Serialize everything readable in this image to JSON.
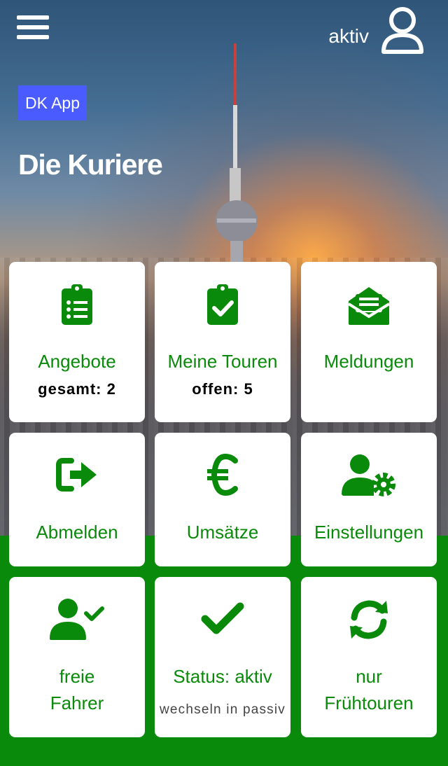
{
  "header": {
    "status_text": "aktiv",
    "app_badge": "DK App",
    "title": "Die Kuriere"
  },
  "tiles": [
    {
      "label": "Angebote",
      "sub": "gesamt: 2",
      "icon": "clipboard-list-icon"
    },
    {
      "label": "Meine Touren",
      "sub": "offen: 5",
      "icon": "clipboard-check-icon"
    },
    {
      "label": "Meldungen",
      "sub": "",
      "icon": "envelope-open-text-icon"
    },
    {
      "label": "Abmelden",
      "sub": "",
      "icon": "sign-out-icon"
    },
    {
      "label": "Umsätze",
      "sub": "",
      "icon": "euro-icon"
    },
    {
      "label": "Einstellungen",
      "sub": "",
      "icon": "user-cog-icon"
    },
    {
      "label_line1": "freie",
      "label_line2": "Fahrer",
      "icon": "user-check-icon"
    },
    {
      "label": "Status: aktiv",
      "sub": "wechseln in passiv",
      "icon": "checkmark-icon"
    },
    {
      "label_line1": "nur",
      "label_line2": "Frühtouren",
      "icon": "sync-icon"
    }
  ],
  "colors": {
    "brand_green": "#0a8a0a",
    "badge_blue": "#4a5cff",
    "tile_bg": "#ffffff"
  }
}
